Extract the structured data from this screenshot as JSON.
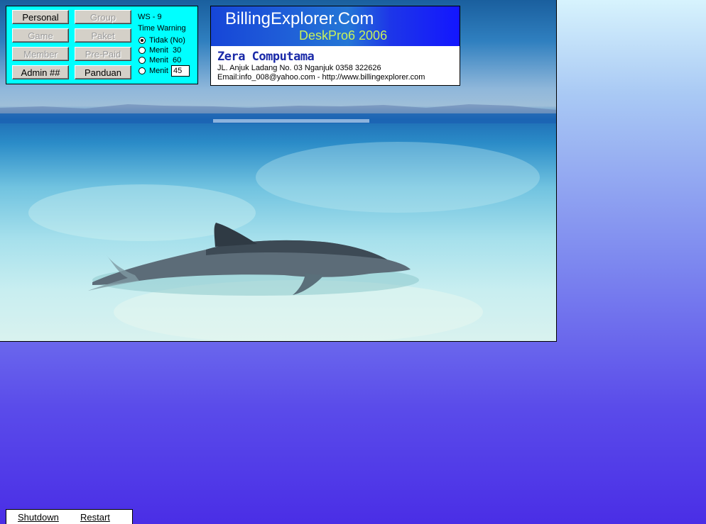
{
  "panel": {
    "buttons": [
      {
        "label": "Personal",
        "enabled": true
      },
      {
        "label": "Group",
        "enabled": false
      },
      {
        "label": "Game",
        "enabled": false
      },
      {
        "label": "Paket",
        "enabled": false
      },
      {
        "label": "Member",
        "enabled": false
      },
      {
        "label": "Pre-Paid",
        "enabled": false
      },
      {
        "label": "Admin ##",
        "enabled": true
      },
      {
        "label": "Panduan",
        "enabled": true
      }
    ],
    "workstation": "WS - 9",
    "time_warning_label": "Time Warning",
    "radio_options": [
      {
        "label": "Tidak (No)",
        "selected": true
      },
      {
        "label": "Menit  30",
        "selected": false
      },
      {
        "label": "Menit  60",
        "selected": false
      },
      {
        "label": "Menit",
        "selected": false
      }
    ],
    "custom_minutes_value": "45"
  },
  "brand": {
    "title": "BillingExplorer.Com",
    "subtitle": "DeskPro6 2006",
    "company": "Zera Computama",
    "address": "JL. Anjuk Ladang No. 03 Nganjuk 0358 322626",
    "contact": "Email:info_008@yahoo.com - http://www.billingexplorer.com"
  },
  "bottom_bar": {
    "shutdown_label": "Shutdown",
    "restart_label": "Restart"
  },
  "colors": {
    "panel_bg": "#00ffff",
    "brand_gradient_start": "#1646d8",
    "brand_gradient_end": "#1316ff",
    "subtitle_color": "#c8f15a",
    "company_color": "#1a2aa8",
    "desktop_bottom": "#4a2ee6"
  },
  "icons": {
    "wallpaper": "dolphin-photo"
  }
}
